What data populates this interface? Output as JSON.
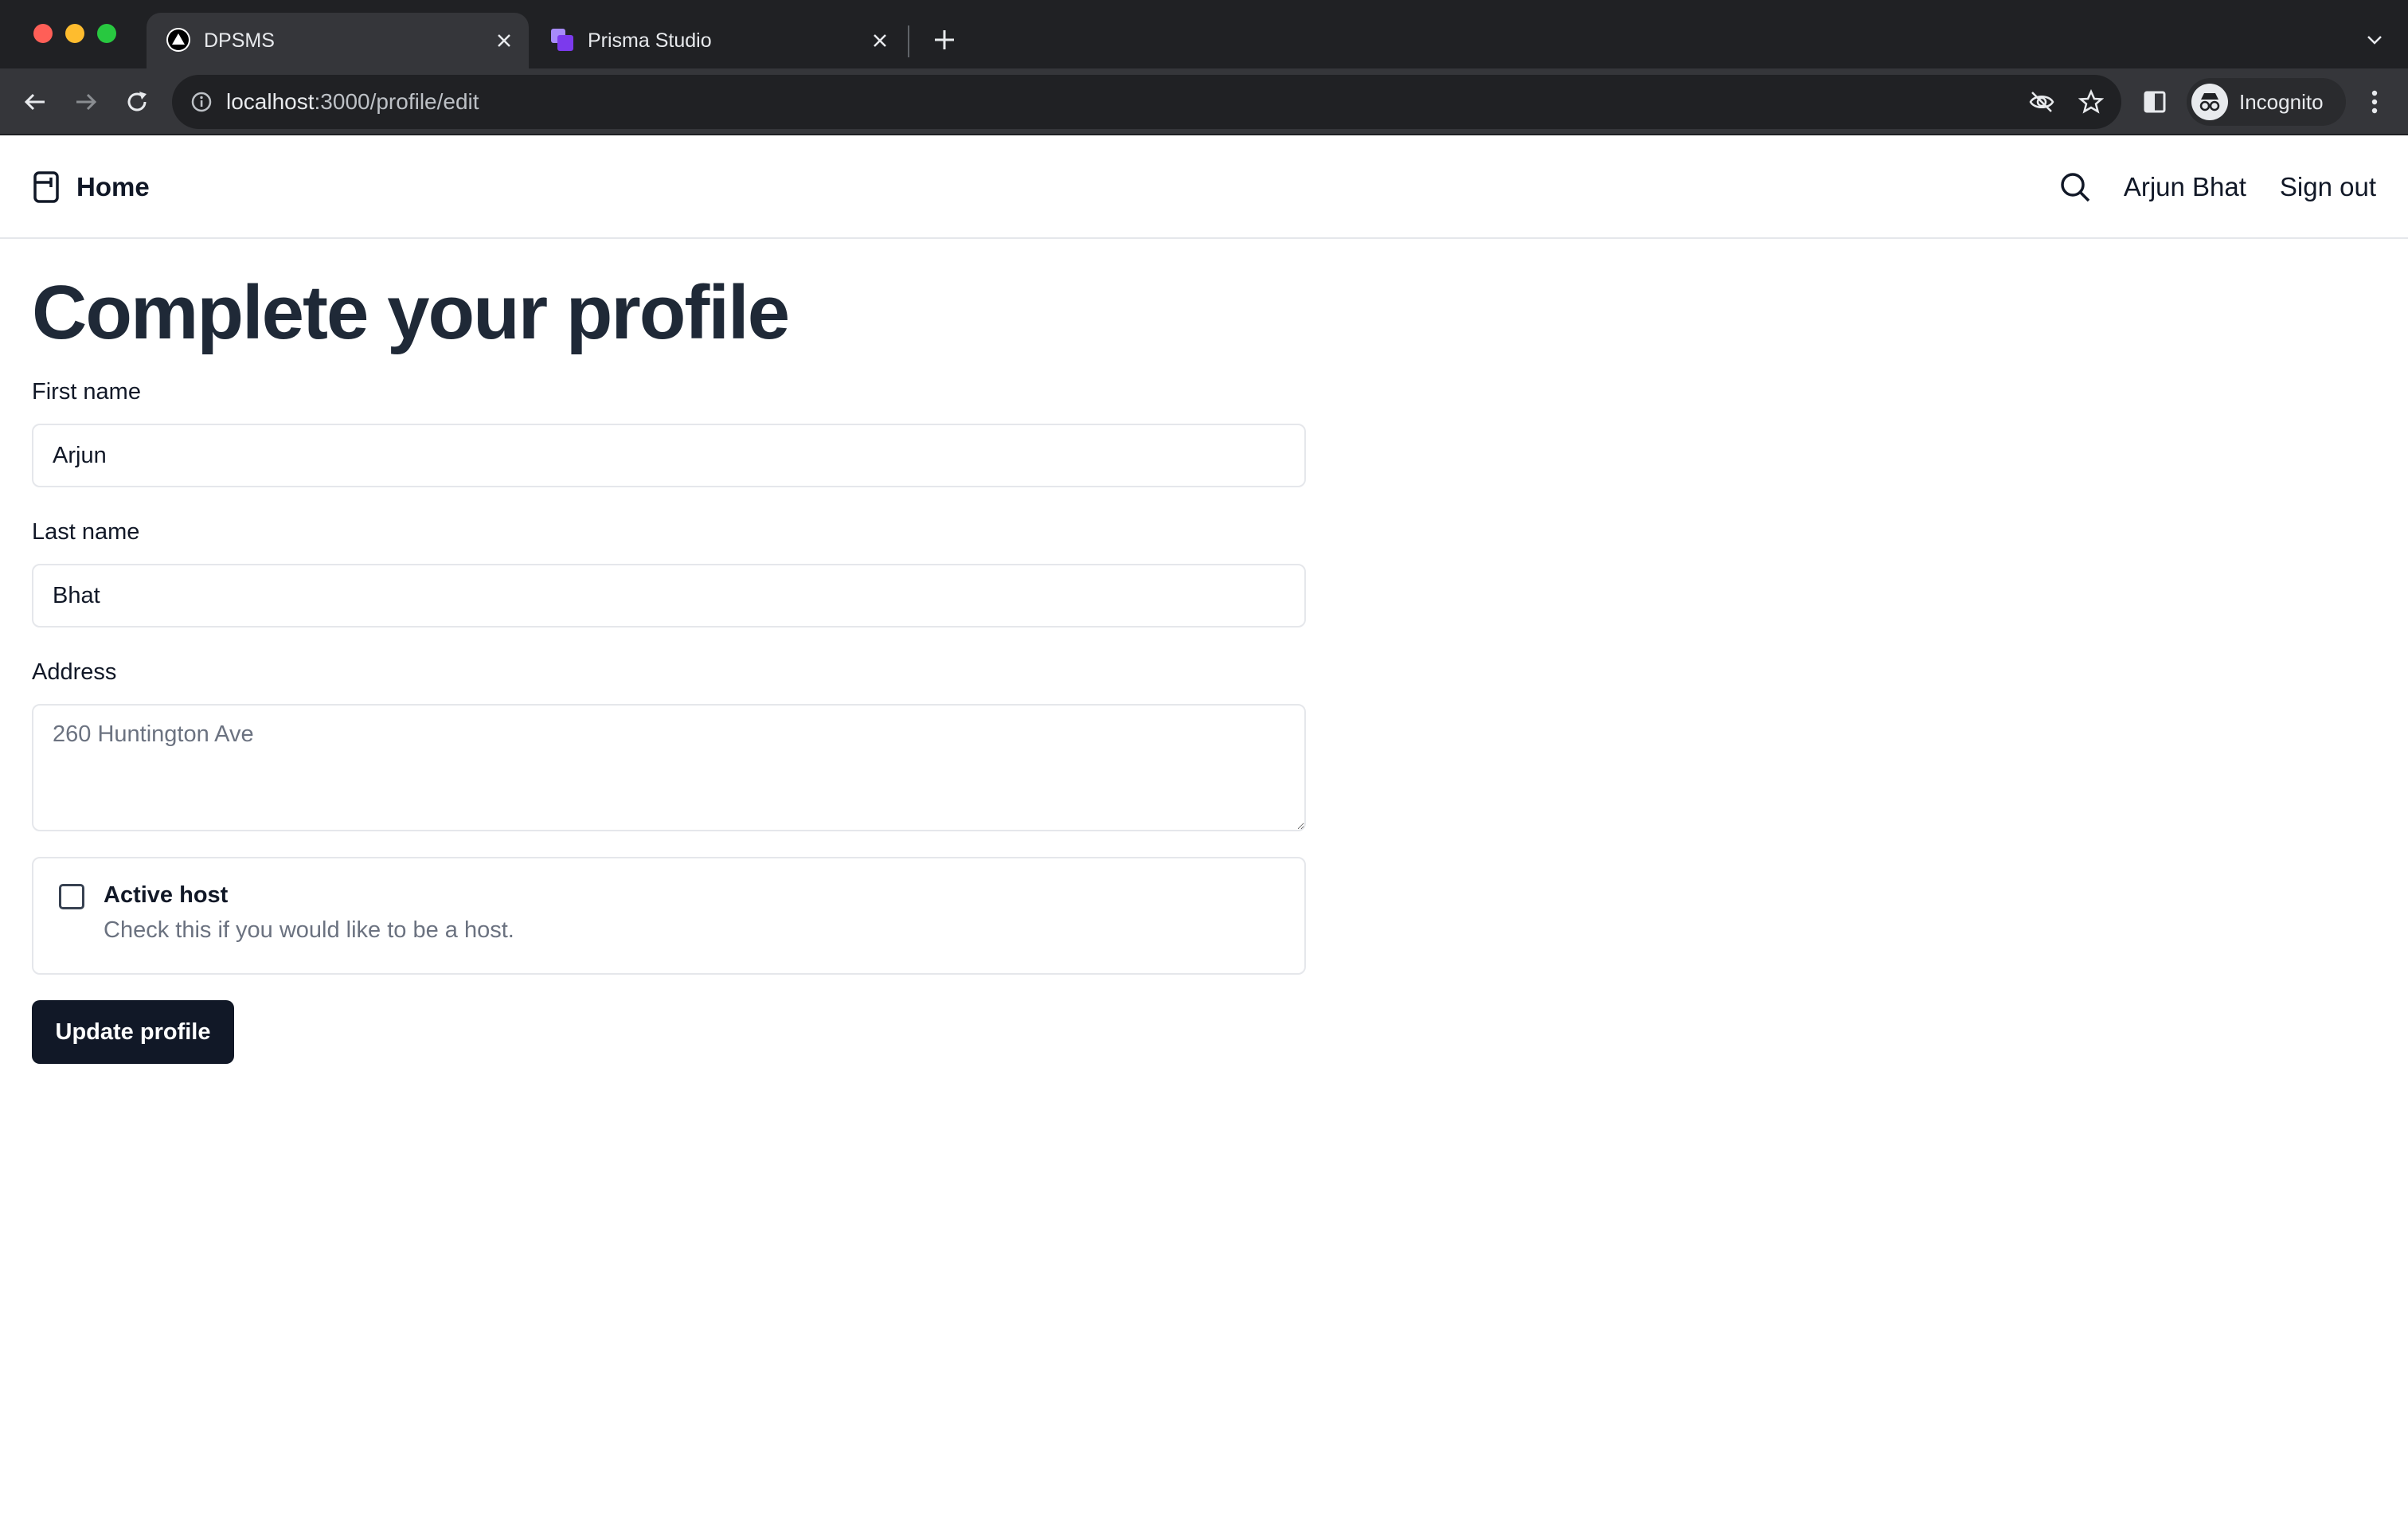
{
  "browser": {
    "tabs": [
      {
        "title": "DPSMS",
        "active": true,
        "icon": "triangle-logo-icon"
      },
      {
        "title": "Prisma Studio",
        "active": false,
        "icon": "prisma-studio-icon"
      }
    ],
    "url_host": "localhost",
    "url_path": ":3000/profile/edit",
    "profile_label": "Incognito"
  },
  "header": {
    "brand_label": "Home",
    "user_name": "Arjun Bhat",
    "signout_label": "Sign out"
  },
  "form": {
    "title": "Complete your profile",
    "first_name_label": "First name",
    "first_name_value": "Arjun",
    "last_name_label": "Last name",
    "last_name_value": "Bhat",
    "address_label": "Address",
    "address_placeholder": "260 Huntington Ave",
    "active_host_label": "Active host",
    "active_host_help": "Check this if you would like to be a host.",
    "active_host_checked": false,
    "submit_label": "Update profile"
  },
  "colors": {
    "chrome_dark": "#202124",
    "chrome_tab": "#35363a",
    "primary_button": "#111827",
    "heading": "#1f2937",
    "muted_text": "#6b7280",
    "border": "#e5e7eb"
  }
}
